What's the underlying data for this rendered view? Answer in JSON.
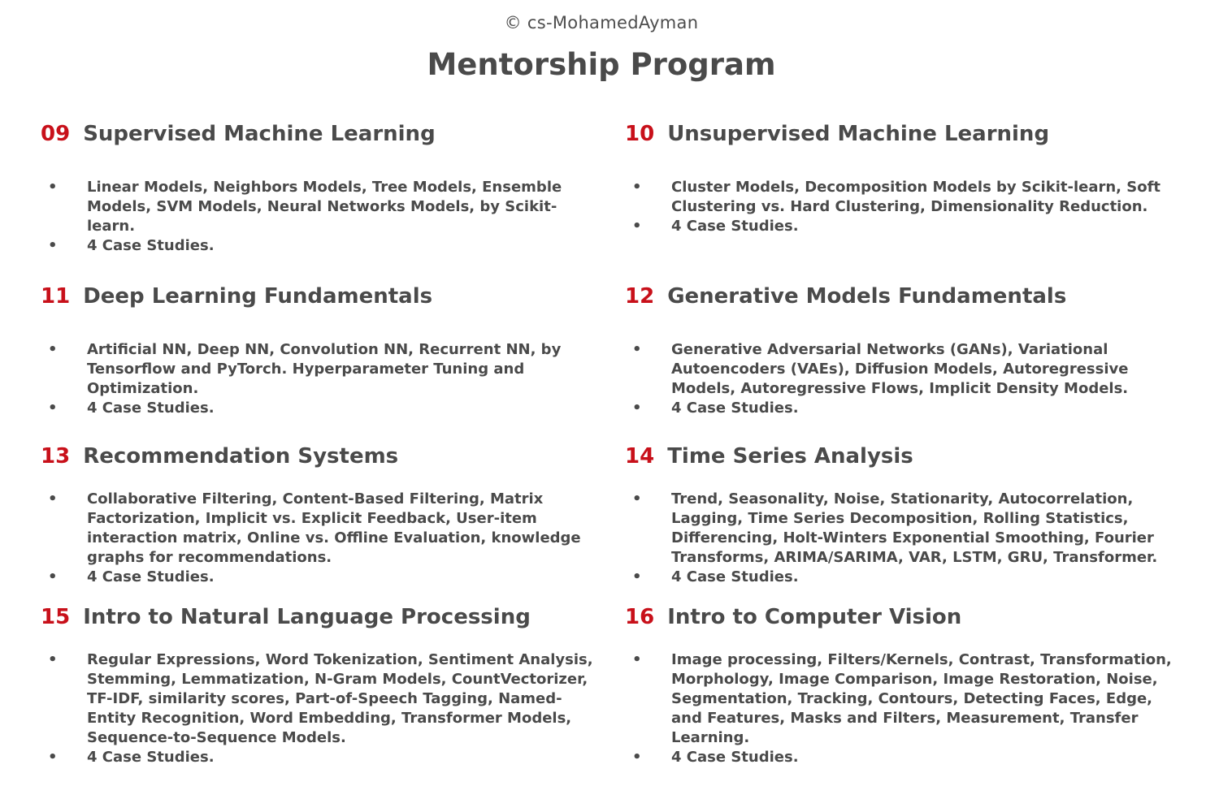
{
  "copyright": "© cs-MohamedAyman",
  "title": "Mentorship Program",
  "modules": [
    {
      "number": "09",
      "title": "Supervised Machine Learning",
      "bullets": [
        "Linear Models, Neighbors Models, Tree Models, Ensemble Models, SVM Models, Neural Networks Models, by Scikit-learn.",
        "4 Case Studies."
      ]
    },
    {
      "number": "10",
      "title": "Unsupervised Machine Learning",
      "bullets": [
        "Cluster Models, Decomposition Models by Scikit-learn, Soft Clustering vs. Hard Clustering, Dimensionality Reduction.",
        "4 Case Studies."
      ]
    },
    {
      "number": "11",
      "title": "Deep Learning Fundamentals",
      "bullets": [
        "Artificial NN, Deep NN, Convolution NN, Recurrent NN, by Tensorflow and PyTorch. Hyperparameter Tuning and Optimization.",
        "4 Case Studies."
      ]
    },
    {
      "number": "12",
      "title": "Generative Models Fundamentals",
      "bullets": [
        "Generative Adversarial Networks (GANs), Variational Autoencoders (VAEs), Diffusion Models, Autoregressive Models, Autoregressive Flows, Implicit Density Models.",
        "4 Case Studies."
      ]
    },
    {
      "number": "13",
      "title": "Recommendation Systems",
      "bullets": [
        "Collaborative Filtering, Content-Based Filtering, Matrix Factorization, Implicit vs. Explicit Feedback, User-item interaction matrix, Online vs. Offline Evaluation, knowledge graphs for recommendations.",
        "4 Case Studies."
      ]
    },
    {
      "number": "14",
      "title": "Time Series Analysis",
      "bullets": [
        "Trend, Seasonality, Noise, Stationarity, Autocorrelation, Lagging, Time Series Decomposition, Rolling Statistics, Differencing, Holt-Winters Exponential Smoothing, Fourier Transforms, ARIMA/SARIMA, VAR, LSTM, GRU, Transformer.",
        "4 Case Studies."
      ]
    },
    {
      "number": "15",
      "title": "Intro to Natural Language Processing",
      "bullets": [
        "Regular Expressions, Word Tokenization, Sentiment Analysis, Stemming, Lemmatization, N-Gram Models, CountVectorizer, TF-IDF, similarity scores, Part-of-Speech Tagging, Named-Entity Recognition, Word Embedding, Transformer Models, Sequence-to-Sequence Models.",
        "4 Case Studies."
      ]
    },
    {
      "number": "16",
      "title": "Intro to Computer Vision",
      "bullets": [
        "Image processing, Filters/Kernels, Contrast, Transformation, Morphology, Image Comparison, Image Restoration, Noise, Segmentation, Tracking, Contours, Detecting Faces, Edge, and Features, Masks and Filters, Measurement, Transfer Learning.",
        "4 Case Studies."
      ]
    }
  ]
}
